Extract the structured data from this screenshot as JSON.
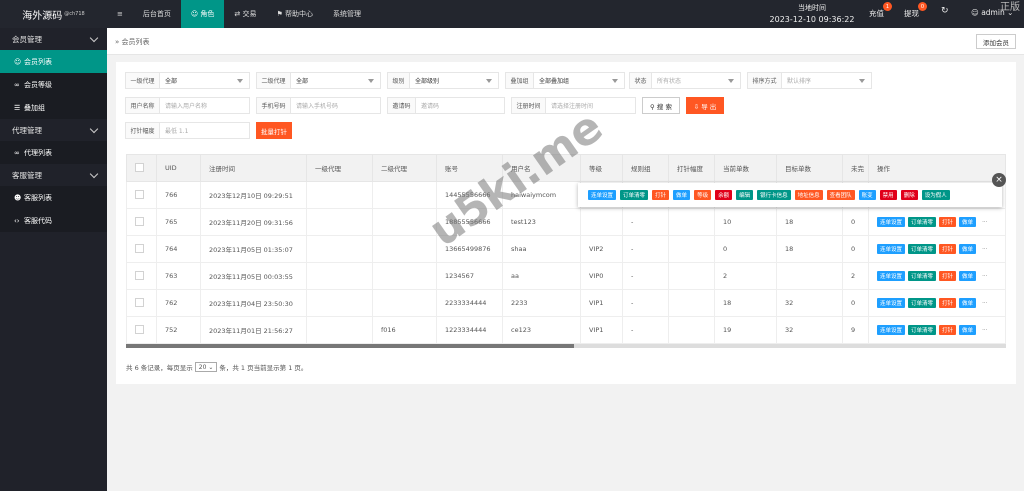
{
  "app": {
    "logo": "海外源码",
    "logo_sup": "@ch718"
  },
  "sidebar": [
    {
      "type": "group",
      "label": "会员管理"
    },
    {
      "type": "item",
      "label": "会员列表",
      "icon": "user-icon",
      "glyph": "☺",
      "active": true
    },
    {
      "type": "item",
      "label": "会员等级",
      "icon": "link-icon",
      "glyph": "∞"
    },
    {
      "type": "item",
      "label": "叠加组",
      "icon": "list-icon",
      "glyph": "☰"
    },
    {
      "type": "group",
      "label": "代理管理"
    },
    {
      "type": "item",
      "label": "代理列表",
      "icon": "link-icon",
      "glyph": "∞"
    },
    {
      "type": "group",
      "label": "客服管理"
    },
    {
      "type": "item",
      "label": "客服列表",
      "icon": "users-icon",
      "glyph": "☻"
    },
    {
      "type": "item",
      "label": "客服代码",
      "icon": "code-icon",
      "glyph": "‹›"
    }
  ],
  "topnav": [
    {
      "label": "≡",
      "name": "menu-toggle-icon"
    },
    {
      "label": "后台首页",
      "name": "nav-home"
    },
    {
      "label": "☺ 角色",
      "name": "nav-role",
      "active": true
    },
    {
      "label": "⇄ 交易",
      "name": "nav-trade"
    },
    {
      "label": "⚑ 帮助中心",
      "name": "nav-help"
    },
    {
      "label": "系统管理",
      "name": "nav-system"
    }
  ],
  "header": {
    "time_label": "当地时间",
    "time_value": "2023-12-10 09:36:22",
    "recharge": "充值",
    "recharge_count": "1",
    "withdraw": "提现",
    "withdraw_count": "0",
    "refresh": "↻",
    "user": "☺ admin",
    "user_caret": "⌄"
  },
  "breadcrumb": "» 会员列表",
  "add_button": "添加会员",
  "filters": {
    "agent1": {
      "label": "一级代理",
      "value": "全部"
    },
    "agent2": {
      "label": "二级代理",
      "value": "全部"
    },
    "level": {
      "label": "级别",
      "value": "全部级别"
    },
    "stack": {
      "label": "叠加组",
      "value": "全部叠加组"
    },
    "status": {
      "label": "状态",
      "placeholder": "所有状态"
    },
    "sort": {
      "label": "排序方式",
      "placeholder": "默认排序"
    },
    "username": {
      "label": "用户名称",
      "placeholder": "请输入用户名称"
    },
    "phone": {
      "label": "手机号码",
      "placeholder": "请输入手机号码"
    },
    "invite": {
      "label": "邀请码",
      "placeholder": "邀请码"
    },
    "regtime": {
      "label": "注册时间",
      "placeholder": "请选择注册时间"
    },
    "search_btn": "⚲ 搜 索",
    "export_btn": "⇩ 导 出",
    "range": {
      "label": "打针幅度",
      "placeholder": "最低 1.1"
    },
    "batch_btn": "批量打针"
  },
  "table": {
    "headers": [
      "",
      "UID",
      "注册时间",
      "一级代理",
      "二级代理",
      "账号",
      "用户名",
      "等级",
      "规则组",
      "打针幅度",
      "当前单数",
      "目标单数",
      "未完",
      "操作"
    ],
    "rows": [
      {
        "uid": "766",
        "reg": "2023年12月10日 09:29:51",
        "a1": "",
        "a2": "",
        "acct": "14455556666",
        "user": "haiwaiymcom",
        "level": "",
        "rule": "",
        "range": "",
        "cur": "",
        "target": "",
        "unfinished": ""
      },
      {
        "uid": "765",
        "reg": "2023年11月20日 09:31:56",
        "a1": "",
        "a2": "",
        "acct": "18855556666",
        "user": "test123",
        "level": "",
        "rule": "-",
        "range": "",
        "cur": "10",
        "target": "18",
        "unfinished": "0"
      },
      {
        "uid": "764",
        "reg": "2023年11月05日 01:35:07",
        "a1": "",
        "a2": "",
        "acct": "13665499876",
        "user": "shaa",
        "level": "VIP2",
        "rule": "-",
        "range": "",
        "cur": "0",
        "target": "18",
        "unfinished": "0"
      },
      {
        "uid": "763",
        "reg": "2023年11月05日 00:03:55",
        "a1": "",
        "a2": "",
        "acct": "1234567",
        "user": "aa",
        "level": "VIP0",
        "rule": "-",
        "range": "",
        "cur": "2",
        "target": "",
        "unfinished": "2"
      },
      {
        "uid": "762",
        "reg": "2023年11月04日 23:50:30",
        "a1": "",
        "a2": "",
        "acct": "2233334444",
        "user": "2233",
        "level": "VIP1",
        "rule": "-",
        "range": "",
        "cur": "18",
        "target": "32",
        "unfinished": "0"
      },
      {
        "uid": "752",
        "reg": "2023年11月01日 21:56:27",
        "a1": "",
        "a2": "f016",
        "acct": "1223334444",
        "user": "ce123",
        "level": "VIP1",
        "rule": "-",
        "range": "",
        "cur": "19",
        "target": "32",
        "unfinished": "9"
      }
    ],
    "row_ops": [
      {
        "label": "连单设置",
        "color": "#1e9fff"
      },
      {
        "label": "订单清零",
        "color": "#009688"
      },
      {
        "label": "打针",
        "color": "#ff5722"
      },
      {
        "label": "做单",
        "color": "#1e9fff"
      },
      {
        "label": "···",
        "color": ""
      }
    ]
  },
  "popup_ops": [
    {
      "label": "连单设置",
      "color": "#1e9fff"
    },
    {
      "label": "订单清零",
      "color": "#009688"
    },
    {
      "label": "打针",
      "color": "#ff5722"
    },
    {
      "label": "做单",
      "color": "#1e9fff"
    },
    {
      "label": "等级",
      "color": "#ff5722"
    },
    {
      "label": "余额",
      "color": "#e0001a"
    },
    {
      "label": "编辑",
      "color": "#009688"
    },
    {
      "label": "银行卡信息",
      "color": "#009688"
    },
    {
      "label": "地址信息",
      "color": "#ff5722"
    },
    {
      "label": "查看团队",
      "color": "#ff5722"
    },
    {
      "label": "账变",
      "color": "#1e9fff"
    },
    {
      "label": "禁用",
      "color": "#e0001a"
    },
    {
      "label": "删除",
      "color": "#e0001a"
    },
    {
      "label": "设为假人",
      "color": "#009688"
    }
  ],
  "pagination": {
    "prefix": "共 6 条记录，每页显示",
    "per_page": "20",
    "suffix": "条，共 1 页当前显示第 1 页。"
  },
  "watermark": "u5ki.me",
  "watermark_corner": "正版"
}
